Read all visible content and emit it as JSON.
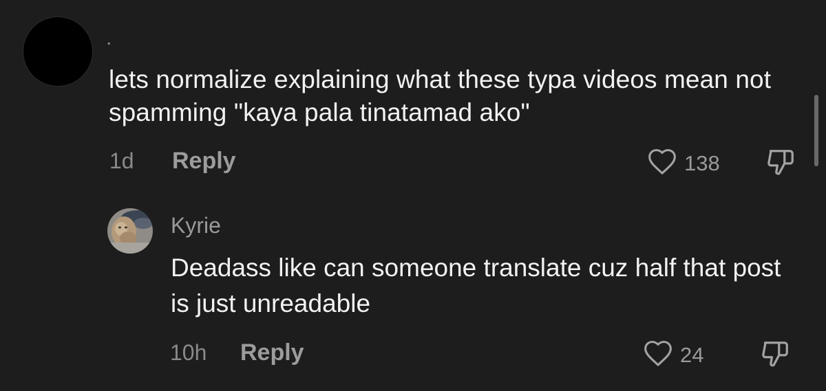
{
  "comments": [
    {
      "username": ".",
      "text": "lets normalize explaining what these typa videos mean not spamming \"kaya pala tinatamad ako\"",
      "time": "1d",
      "reply_label": "Reply",
      "likes": "138",
      "icons": {
        "avatar": "black-avatar",
        "like": "heart-outline-icon",
        "dislike": "thumbs-down-outline-icon"
      }
    },
    {
      "username": "Kyrie",
      "text": "Deadass like can someone translate cuz half that post is just unreadable",
      "time": "10h",
      "reply_label": "Reply",
      "likes": "24",
      "icons": {
        "avatar": "cat-photo-avatar",
        "like": "heart-outline-icon",
        "dislike": "thumbs-down-outline-icon"
      }
    }
  ],
  "colors": {
    "background": "#1d1d1e",
    "text_primary": "#f2f2f2",
    "text_secondary": "#8c8c8c",
    "scrollbar": "#6a6a6a"
  }
}
